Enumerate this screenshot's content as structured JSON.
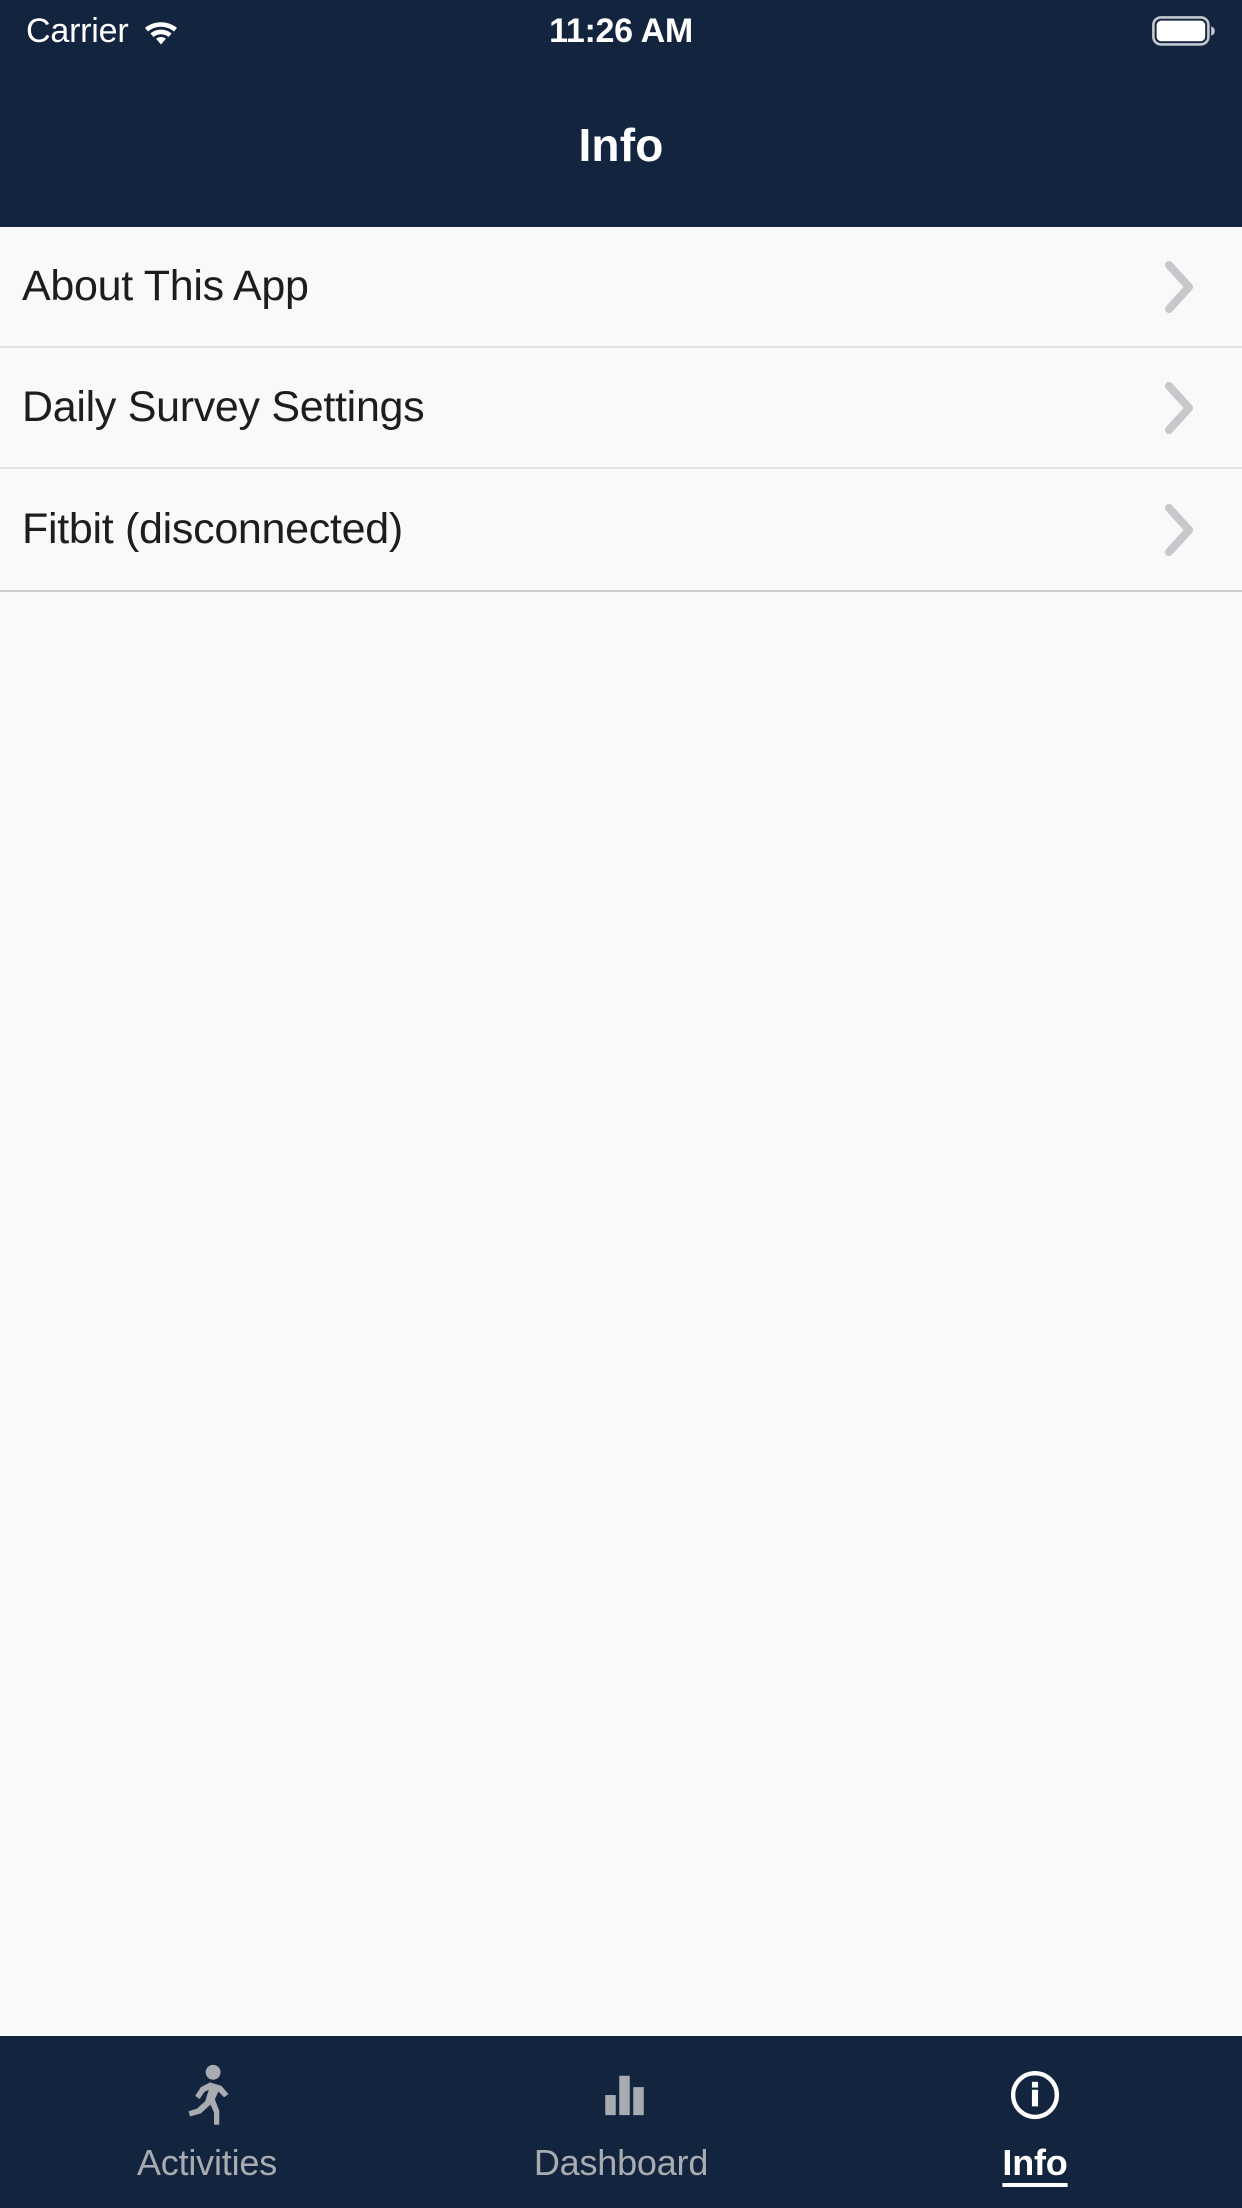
{
  "status_bar": {
    "carrier": "Carrier",
    "wifi_icon": "wifi-icon",
    "time": "11:26 AM",
    "battery_icon": "battery-full-icon"
  },
  "nav_bar": {
    "title": "Info"
  },
  "list": {
    "rows": [
      {
        "label": "About This App",
        "chevron_icon": "chevron-right-icon"
      },
      {
        "label": "Daily Survey Settings",
        "chevron_icon": "chevron-right-icon"
      },
      {
        "label": "Fitbit (disconnected)",
        "chevron_icon": "chevron-right-icon"
      }
    ]
  },
  "tab_bar": {
    "tabs": [
      {
        "label": "Activities",
        "icon": "running-person-icon",
        "active": false
      },
      {
        "label": "Dashboard",
        "icon": "bar-chart-icon",
        "active": false
      },
      {
        "label": "Info",
        "icon": "info-circle-icon",
        "active": true
      }
    ]
  },
  "colors": {
    "navy": "#13243f",
    "content_bg": "#f9f9f9",
    "row_text": "#1d1d1f",
    "separator": "#e2e2e4",
    "chevron": "#c7c7cc",
    "tab_inactive": "#a8acb1",
    "tab_active": "#ffffff"
  }
}
